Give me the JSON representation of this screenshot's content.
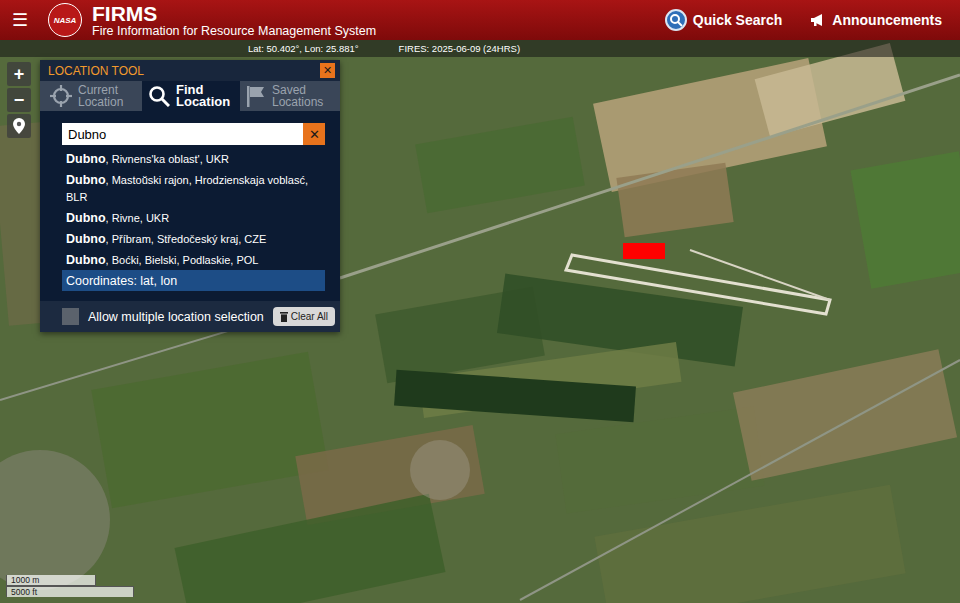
{
  "header": {
    "menu_icon": "☰",
    "logo": "NASA",
    "title": "FIRMS",
    "subtitle": "Fire Information for Resource Management System",
    "actions": [
      {
        "label": "Quick Search"
      },
      {
        "label": "Announcements"
      }
    ]
  },
  "info_bar": {
    "coordinates": "Lat: 50.402°, Lon: 25.881°",
    "fires": "FIRES: 2025-06-09 (24HRS)"
  },
  "map_controls": [
    "+",
    "−"
  ],
  "location_tool": {
    "title": "LOCATION TOOL",
    "close": "✕",
    "tabs": [
      {
        "label": "Current Location",
        "selected": false
      },
      {
        "label": "Find Location",
        "selected": true
      },
      {
        "label": "Saved Locations",
        "selected": false
      }
    ],
    "search": {
      "value": "Dubno",
      "clear": "✕"
    },
    "results": [
      {
        "name": "Dubno",
        "detail": ", Rivnens'ka oblast', UKR",
        "selected": false
      },
      {
        "name": "Dubno",
        "detail": ", Mastoŭski rajon, Hrodzienskaja voblasć, BLR",
        "selected": false
      },
      {
        "name": "Dubno",
        "detail": ", Rivne, UKR",
        "selected": false
      },
      {
        "name": "Dubno",
        "detail": ", Příbram, Středočeský kraj, CZE",
        "selected": false
      },
      {
        "name": "Dubno",
        "detail": ", Boćki, Bielski, Podlaskie, POL",
        "selected": false
      },
      {
        "name": "",
        "detail": "Coordinates: lat, lon",
        "selected": true
      }
    ],
    "multiple_selection": {
      "label": "Allow multiple location selection",
      "checked": false
    },
    "clear_button": "Clear All"
  },
  "scale": [
    "1000 m",
    "5000 ft"
  ]
}
